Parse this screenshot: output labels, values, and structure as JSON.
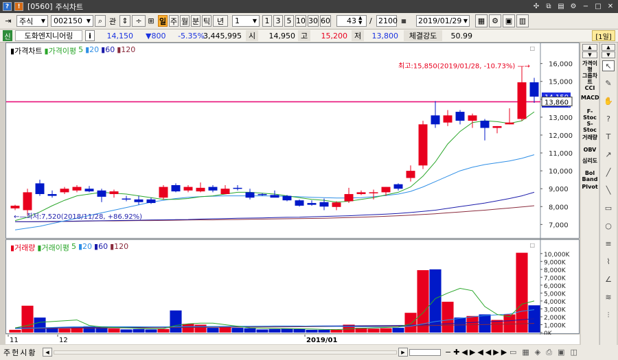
{
  "window": {
    "code": "[0560]",
    "title": "주식차트",
    "btn1": "?",
    "btn2": "!"
  },
  "toolbar": {
    "market": "주식",
    "stock_code": "002150",
    "label_gwan": "관",
    "periods": [
      "주",
      "월",
      "분",
      "틱",
      "년"
    ],
    "period_day": "일",
    "multiplier": "1",
    "minutes": [
      "1",
      "3",
      "5",
      "10",
      "30",
      "60"
    ],
    "display_count": "43",
    "total_count": "2100",
    "date": "2019/01/29"
  },
  "info": {
    "badge": "신",
    "name": "도화엔지니어링",
    "i": "i",
    "price": "14,150",
    "change": "▼800",
    "rate": "-5.35%",
    "volume": "3,445,995",
    "open_label": "시",
    "open": "14,950",
    "high_label": "고",
    "high": "15,200",
    "low_label": "저",
    "low": "13,800",
    "strength_label": "체결강도",
    "strength": "50.99",
    "period_badge": "[1일]"
  },
  "price_chart": {
    "legend": [
      {
        "text": "▮가격차트",
        "color": "#000000"
      },
      {
        "text": "▮가격이평",
        "color": "#2aa62a"
      },
      {
        "text": "5",
        "color": "#2aa62a"
      },
      {
        "text": "▮20",
        "color": "#2f8fe6"
      },
      {
        "text": "▮60",
        "color": "#1b1baa"
      },
      {
        "text": "▮120",
        "color": "#8a2b3c"
      }
    ],
    "max_label": "최고:15,850(2019/01/28, -10.73%)",
    "min_label": "최저:7,520(2018/11/28, +86.92%)",
    "current_box": "14,150",
    "line_box": "13,860",
    "pct_box": "3%)",
    "line_value": 13860
  },
  "volume_chart": {
    "legend": [
      {
        "text": "▮거래량",
        "color": "#e8001e"
      },
      {
        "text": "▮거래이평",
        "color": "#2aa62a"
      },
      {
        "text": "5",
        "color": "#2aa62a"
      },
      {
        "text": "▮20",
        "color": "#2f8fe6"
      },
      {
        "text": "▮60",
        "color": "#1b1baa"
      },
      {
        "text": "▮120",
        "color": "#8a2b3c"
      }
    ]
  },
  "chart_data": {
    "type": "candlestick",
    "price_axis": {
      "ylim": [
        6400,
        16600
      ],
      "ticks": [
        7000,
        8000,
        9000,
        10000,
        11000,
        12000,
        13000,
        14000,
        15000,
        16000
      ],
      "tick_labels": [
        "7,000",
        "8,000",
        "9,000",
        "10,000",
        "11,000",
        "12,000",
        "13,000",
        "14,000",
        "15,000",
        "16,000"
      ]
    },
    "volume_axis": {
      "ylim": [
        0,
        10500
      ],
      "ticks": [
        0,
        1000,
        2000,
        3000,
        4000,
        5000,
        6000,
        7000,
        8000,
        9000,
        10000
      ],
      "tick_labels": [
        "0K",
        "1,000K",
        "2,000K",
        "3,000K",
        "4,000K",
        "5,000K",
        "6,000K",
        "7,000K",
        "8,000K",
        "9,000K",
        "10,000K"
      ]
    },
    "x_labels": [
      {
        "index": 0,
        "text": "11"
      },
      {
        "index": 4,
        "text": "12"
      },
      {
        "index": 24,
        "text": "2019/01"
      }
    ],
    "candles": [
      {
        "o": 7900,
        "h": 8100,
        "l": 7800,
        "c": 8050
      },
      {
        "o": 7800,
        "h": 9000,
        "l": 7520,
        "c": 8800
      },
      {
        "o": 9300,
        "h": 9500,
        "l": 8600,
        "c": 8700
      },
      {
        "o": 8700,
        "h": 8900,
        "l": 8500,
        "c": 8600
      },
      {
        "o": 8800,
        "h": 9100,
        "l": 8700,
        "c": 9000
      },
      {
        "o": 8900,
        "h": 9200,
        "l": 8800,
        "c": 9100
      },
      {
        "o": 9000,
        "h": 9150,
        "l": 8800,
        "c": 8850
      },
      {
        "o": 8900,
        "h": 9000,
        "l": 8250,
        "c": 8550
      },
      {
        "o": 8700,
        "h": 8950,
        "l": 8500,
        "c": 8850
      },
      {
        "o": 8450,
        "h": 8600,
        "l": 8300,
        "c": 8400
      },
      {
        "o": 8400,
        "h": 8600,
        "l": 8100,
        "c": 8250
      },
      {
        "o": 8400,
        "h": 8500,
        "l": 8150,
        "c": 8200
      },
      {
        "o": 8500,
        "h": 9200,
        "l": 8400,
        "c": 9100
      },
      {
        "o": 9200,
        "h": 9300,
        "l": 8800,
        "c": 8850
      },
      {
        "o": 8900,
        "h": 9200,
        "l": 8800,
        "c": 9100
      },
      {
        "o": 8850,
        "h": 9350,
        "l": 8800,
        "c": 9050
      },
      {
        "o": 9100,
        "h": 9200,
        "l": 8800,
        "c": 8900
      },
      {
        "o": 8700,
        "h": 9200,
        "l": 8700,
        "c": 9000
      },
      {
        "o": 9050,
        "h": 9200,
        "l": 8900,
        "c": 9000
      },
      {
        "o": 8800,
        "h": 9000,
        "l": 8400,
        "c": 8500
      },
      {
        "o": 8700,
        "h": 8750,
        "l": 8600,
        "c": 8650
      },
      {
        "o": 8650,
        "h": 8900,
        "l": 8600,
        "c": 8500
      },
      {
        "o": 8600,
        "h": 8650,
        "l": 8300,
        "c": 8350
      },
      {
        "o": 8350,
        "h": 8400,
        "l": 8000,
        "c": 8050
      },
      {
        "o": 8200,
        "h": 8350,
        "l": 8050,
        "c": 8100
      },
      {
        "o": 8250,
        "h": 8450,
        "l": 7800,
        "c": 8000
      },
      {
        "o": 7980,
        "h": 8300,
        "l": 7800,
        "c": 8230
      },
      {
        "o": 8300,
        "h": 9050,
        "l": 8200,
        "c": 8700
      },
      {
        "o": 8700,
        "h": 8900,
        "l": 8650,
        "c": 8800
      },
      {
        "o": 8750,
        "h": 8950,
        "l": 8400,
        "c": 8800
      },
      {
        "o": 8800,
        "h": 9100,
        "l": 8600,
        "c": 9100
      },
      {
        "o": 9250,
        "h": 9300,
        "l": 8900,
        "c": 9000
      },
      {
        "o": 9600,
        "h": 10300,
        "l": 9400,
        "c": 10000
      },
      {
        "o": 10300,
        "h": 12800,
        "l": 10100,
        "c": 12600
      },
      {
        "o": 13100,
        "h": 13900,
        "l": 12400,
        "c": 12600
      },
      {
        "o": 12700,
        "h": 13400,
        "l": 12500,
        "c": 13100
      },
      {
        "o": 13300,
        "h": 13400,
        "l": 12600,
        "c": 12800
      },
      {
        "o": 12800,
        "h": 13200,
        "l": 12400,
        "c": 13100
      },
      {
        "o": 12800,
        "h": 12900,
        "l": 11700,
        "c": 12400
      },
      {
        "o": 12400,
        "h": 12500,
        "l": 12100,
        "c": 12500
      },
      {
        "o": 12600,
        "h": 13500,
        "l": 12600,
        "c": 12700
      },
      {
        "o": 12900,
        "h": 15850,
        "l": 12800,
        "c": 14950
      },
      {
        "o": 14950,
        "h": 15200,
        "l": 13800,
        "c": 14150
      }
    ],
    "volume": [
      350,
      3400,
      1900,
      600,
      500,
      650,
      800,
      600,
      500,
      400,
      450,
      400,
      450,
      2800,
      1100,
      1000,
      600,
      650,
      600,
      550,
      400,
      450,
      500,
      450,
      350,
      350,
      350,
      1000,
      600,
      500,
      550,
      600,
      2500,
      7900,
      8000,
      3900,
      1900,
      2100,
      2300,
      1600,
      2300,
      10100,
      3450
    ],
    "price_ma": {
      "ma5": [
        7220,
        7400,
        7700,
        8050,
        8350,
        8600,
        8700,
        8800,
        8750,
        8700,
        8600,
        8500,
        8400,
        8400,
        8450,
        8550,
        8600,
        8700,
        8800,
        8800,
        8750,
        8700,
        8600,
        8500,
        8400,
        8350,
        8250,
        8300,
        8400,
        8500,
        8650,
        8800,
        9100,
        9700,
        10500,
        11500,
        12200,
        12700,
        12800,
        12750,
        12650,
        12800,
        13300
      ],
      "ma20": [
        6700,
        6800,
        6900,
        7050,
        7200,
        7350,
        7500,
        7650,
        7800,
        7950,
        8100,
        8250,
        8350,
        8450,
        8520,
        8560,
        8580,
        8600,
        8600,
        8600,
        8600,
        8590,
        8570,
        8550,
        8520,
        8500,
        8480,
        8480,
        8500,
        8550,
        8620,
        8700,
        8850,
        9100,
        9400,
        9700,
        10000,
        10200,
        10350,
        10450,
        10550,
        10700,
        10900
      ],
      "ma60": [
        7150,
        7150,
        7160,
        7170,
        7180,
        7190,
        7200,
        7210,
        7220,
        7230,
        7240,
        7250,
        7260,
        7270,
        7280,
        7300,
        7320,
        7330,
        7350,
        7360,
        7370,
        7390,
        7400,
        7410,
        7430,
        7450,
        7470,
        7490,
        7520,
        7550,
        7580,
        7620,
        7670,
        7730,
        7800,
        7900,
        8000,
        8100,
        8200,
        8320,
        8450,
        8600,
        8800
      ],
      "ma120": [
        7150,
        7150,
        7160,
        7160,
        7170,
        7180,
        7190,
        7200,
        7200,
        7210,
        7220,
        7220,
        7230,
        7240,
        7250,
        7260,
        7260,
        7270,
        7280,
        7290,
        7300,
        7310,
        7320,
        7330,
        7340,
        7350,
        7370,
        7390,
        7410,
        7430,
        7460,
        7490,
        7520,
        7560,
        7600,
        7650,
        7700,
        7750,
        7800,
        7860,
        7920,
        7980,
        8050
      ]
    },
    "volume_ma": {
      "ma5": [
        600,
        900,
        1300,
        1400,
        1500,
        1600,
        900,
        700,
        650,
        600,
        550,
        500,
        500,
        900,
        1100,
        1200,
        1200,
        1000,
        800,
        600,
        560,
        520,
        500,
        480,
        450,
        400,
        380,
        450,
        550,
        600,
        650,
        700,
        1100,
        2500,
        4300,
        5000,
        5600,
        5300,
        3300,
        2300,
        2000,
        3600,
        4000
      ],
      "ma20": [
        500,
        550,
        600,
        650,
        700,
        750,
        750,
        750,
        750,
        750,
        740,
        730,
        720,
        740,
        760,
        770,
        780,
        790,
        800,
        810,
        820,
        830,
        830,
        830,
        820,
        800,
        780,
        760,
        740,
        720,
        700,
        710,
        800,
        1100,
        1400,
        1600,
        1800,
        2000,
        2150,
        2250,
        2350,
        2700,
        2900
      ],
      "ma60": [
        600,
        600,
        610,
        620,
        630,
        640,
        650,
        660,
        670,
        680,
        690,
        700,
        710,
        720,
        730,
        740,
        750,
        760,
        770,
        780,
        790,
        800,
        810,
        820,
        830,
        840,
        850,
        860,
        870,
        880,
        890,
        900,
        930,
        980,
        1050,
        1120,
        1200,
        1280,
        1350,
        1420,
        1500,
        1620,
        1750
      ],
      "ma120": [
        520,
        520,
        530,
        540,
        550,
        560,
        570,
        580,
        590,
        600,
        610,
        620,
        630,
        640,
        650,
        660,
        670,
        680,
        690,
        700,
        710,
        720,
        730,
        740,
        750,
        760,
        770,
        780,
        790,
        800,
        810,
        820,
        840,
        870,
        900,
        930,
        960,
        990,
        1020,
        1050,
        1080,
        1120,
        1160
      ]
    },
    "colors": {
      "up": "#e8001e",
      "down": "#0019c8",
      "ma5": "#2aa62a",
      "ma20": "#2f8fe6",
      "ma60": "#1b1baa",
      "ma120": "#8a2b3c",
      "hline": "#e8107a"
    }
  },
  "right_indicators": [
    "가격이평",
    "그룹차트",
    "CCI",
    "MACD",
    "F-Stoc",
    "S-Stoc",
    "거래량",
    "OBV",
    "심리도",
    "Bol Band",
    "PIvot"
  ],
  "right_tools": [
    "↖",
    "✎",
    "✋",
    "?",
    "T",
    "↗",
    "╱",
    "╲",
    "▭",
    "○",
    "≡",
    "⌇",
    "∠",
    "≋",
    "⫶"
  ],
  "bottom": {
    "tabs": [
      "주",
      "헌",
      "시",
      "황"
    ]
  }
}
